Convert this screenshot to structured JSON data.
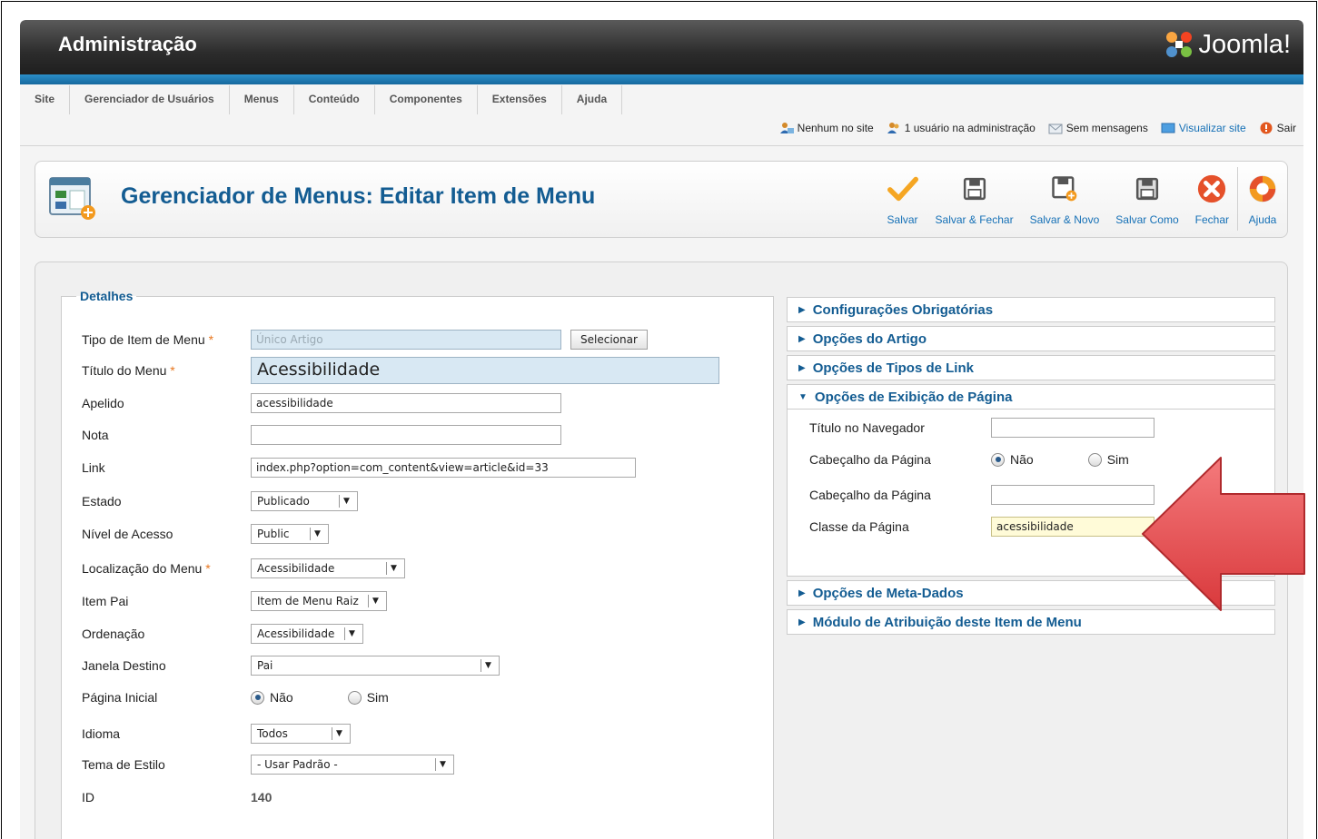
{
  "header": {
    "title": "Administração",
    "logo_text": "Joomla!"
  },
  "menu": [
    "Site",
    "Gerenciador de Usuários",
    "Menus",
    "Conteúdo",
    "Componentes",
    "Extensões",
    "Ajuda"
  ],
  "status": {
    "nobody_site": "Nenhum no site",
    "admin_users": "1 usuário na administração",
    "messages": "Sem mensagens",
    "view_site": "Visualizar site",
    "logout": "Sair"
  },
  "toolbar": {
    "title": "Gerenciador de Menus: Editar Item de Menu",
    "save": "Salvar",
    "save_close": "Salvar & Fechar",
    "save_new": "Salvar & Novo",
    "save_copy": "Salvar Como",
    "close": "Fechar",
    "help": "Ajuda"
  },
  "details": {
    "legend": "Detalhes",
    "required_mark": "*",
    "menu_item_type": {
      "label": "Tipo de Item de Menu",
      "value": "Único Artigo",
      "button": "Selecionar"
    },
    "menu_title": {
      "label": "Título do Menu",
      "value": "Acessibilidade"
    },
    "alias": {
      "label": "Apelido",
      "value": "acessibilidade"
    },
    "note": {
      "label": "Nota",
      "value": ""
    },
    "link": {
      "label": "Link",
      "value": "index.php?option=com_content&view=article&id=33"
    },
    "status": {
      "label": "Estado",
      "value": "Publicado"
    },
    "access": {
      "label": "Nível de Acesso",
      "value": "Public"
    },
    "menu_location": {
      "label": "Localização do Menu",
      "value": "Acessibilidade"
    },
    "parent_item": {
      "label": "Item Pai",
      "value": "Item de Menu Raiz"
    },
    "ordering": {
      "label": "Ordenação",
      "value": "Acessibilidade"
    },
    "target_window": {
      "label": "Janela Destino",
      "value": "Pai"
    },
    "home_page": {
      "label": "Página Inicial",
      "no": "Não",
      "yes": "Sim",
      "selected": "Não"
    },
    "language": {
      "label": "Idioma",
      "value": "Todos"
    },
    "template_style": {
      "label": "Tema de Estilo",
      "value": "- Usar Padrão -"
    },
    "id": {
      "label": "ID",
      "value": "140"
    }
  },
  "panels": {
    "required_settings": "Configurações Obrigatórias",
    "article_options": "Opções do Artigo",
    "link_type_options": "Opções de Tipos de Link",
    "page_display_options": "Opções de Exibição de Página",
    "page_display": {
      "browser_title": {
        "label": "Título no Navegador",
        "value": ""
      },
      "show_heading": {
        "label": "Cabeçalho da Página",
        "no": "Não",
        "yes": "Sim",
        "selected": "Não"
      },
      "page_heading": {
        "label": "Cabeçalho da Página",
        "value": ""
      },
      "page_class": {
        "label": "Classe da Página",
        "value": "acessibilidade"
      }
    },
    "metadata_options": "Opções de Meta-Dados",
    "module_assignment": "Módulo de Atribuição deste Item de Menu"
  },
  "colors": {
    "accent_blue": "#135c92",
    "link_blue": "#1570b6",
    "header_dark": "#2c2c2c",
    "bar_blue": "#2b8fc9",
    "highlight_yellow": "#fffbd8",
    "arrow_red": "#e0484a"
  }
}
